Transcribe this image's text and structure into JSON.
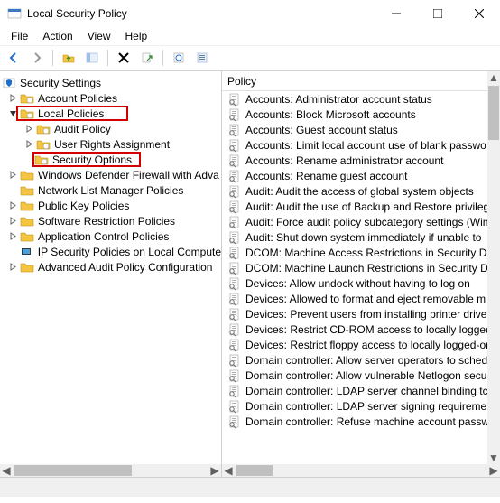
{
  "window": {
    "title": "Local Security Policy",
    "menu": [
      "File",
      "Action",
      "View",
      "Help"
    ]
  },
  "tree": {
    "root": "Security Settings",
    "nodes": [
      {
        "label": "Account Policies"
      },
      {
        "label": "Local Policies"
      },
      {
        "label": "Audit Policy"
      },
      {
        "label": "User Rights Assignment"
      },
      {
        "label": "Security Options"
      },
      {
        "label": "Windows Defender Firewall with Adva"
      },
      {
        "label": "Network List Manager Policies"
      },
      {
        "label": "Public Key Policies"
      },
      {
        "label": "Software Restriction Policies"
      },
      {
        "label": "Application Control Policies"
      },
      {
        "label": "IP Security Policies on Local Compute"
      },
      {
        "label": "Advanced Audit Policy Configuration"
      }
    ]
  },
  "list": {
    "header": "Policy",
    "items": [
      "Accounts: Administrator account status",
      "Accounts: Block Microsoft accounts",
      "Accounts: Guest account status",
      "Accounts: Limit local account use of blank passwo",
      "Accounts: Rename administrator account",
      "Accounts: Rename guest account",
      "Audit: Audit the access of global system objects",
      "Audit: Audit the use of Backup and Restore privileg",
      "Audit: Force audit policy subcategory settings (Win",
      "Audit: Shut down system immediately if unable to",
      "DCOM: Machine Access Restrictions in Security De",
      "DCOM: Machine Launch Restrictions in Security De",
      "Devices: Allow undock without having to log on",
      "Devices: Allowed to format and eject removable m",
      "Devices: Prevent users from installing printer driver",
      "Devices: Restrict CD-ROM access to locally logged-",
      "Devices: Restrict floppy access to locally logged-or",
      "Domain controller: Allow server operators to sched",
      "Domain controller: Allow vulnerable Netlogon secu",
      "Domain controller: LDAP server channel binding tc",
      "Domain controller: LDAP server signing requiremen",
      "Domain controller: Refuse machine account passw"
    ]
  }
}
